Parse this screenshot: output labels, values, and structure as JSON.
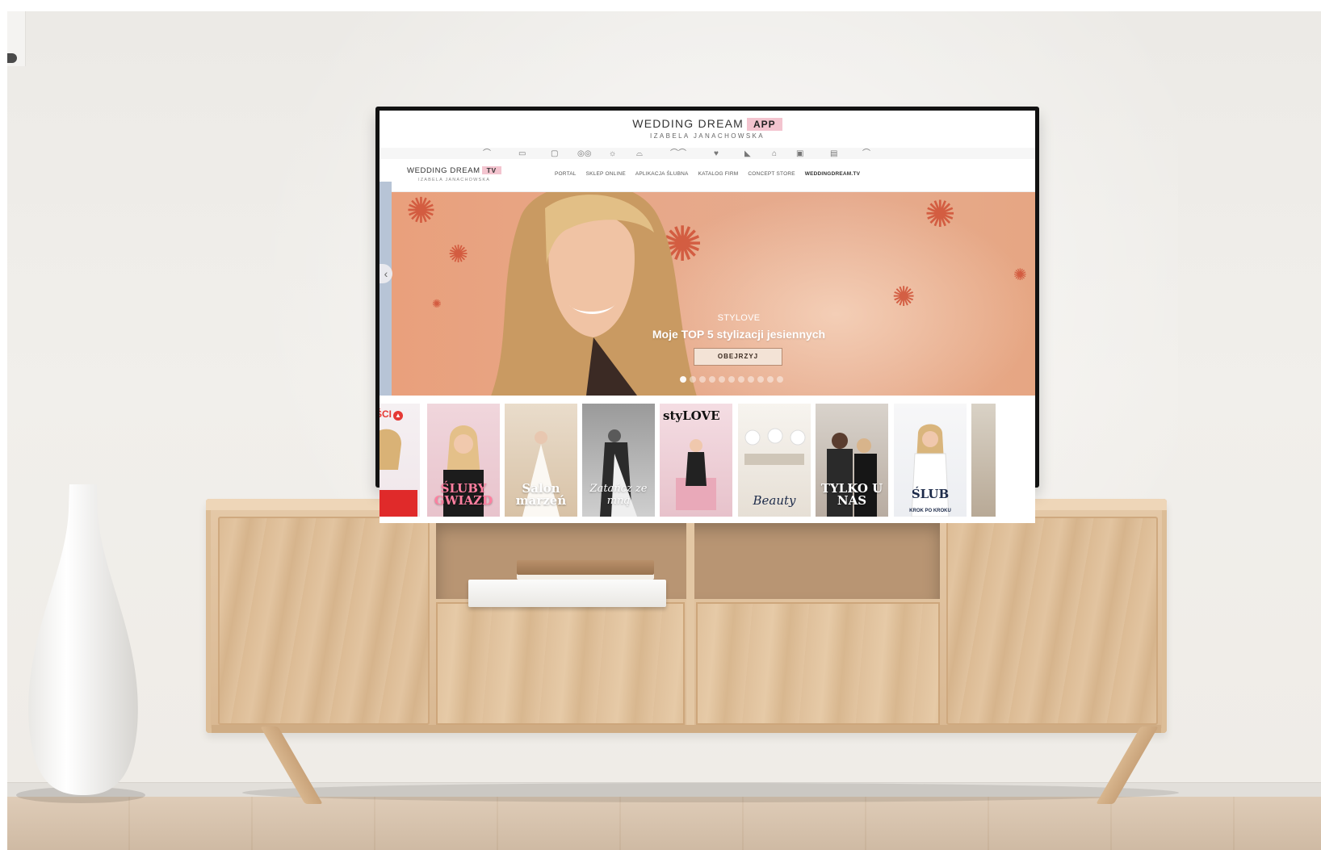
{
  "app_bar": {
    "title": "WEDDING DREAM",
    "badge": "APP",
    "subtitle": "IZABELA JANACHOWSKA"
  },
  "icon_row": [
    "home-icon",
    "calendar-icon",
    "document-icon",
    "rings-icon",
    "sun-icon",
    "person-icon",
    "car-icon",
    "heart-icon",
    "flag-icon",
    "cake-icon",
    "camera-icon",
    "list-icon",
    "music-icon"
  ],
  "site_header": {
    "logo_text": "WEDDING DREAM",
    "logo_badge": "TV",
    "logo_sub": "IZABELA JANACHOWSKA",
    "nav": [
      {
        "label": "PORTAL",
        "active": false
      },
      {
        "label": "SKLEP ONLINE",
        "active": false
      },
      {
        "label": "APLIKACJA ŚLUBNA",
        "active": false
      },
      {
        "label": "KATALOG FIRM",
        "active": false
      },
      {
        "label": "CONCEPT STORE",
        "active": false
      },
      {
        "label": "WEDDINGDREAM.TV",
        "active": true
      }
    ]
  },
  "hero": {
    "label": "STYLOVE",
    "title": "Moje TOP 5 stylizacji jesiennych",
    "button": "OBEJRZYJ",
    "slide_count": 11,
    "active_slide": 1,
    "prev_arrow": "‹"
  },
  "thumbnails": [
    {
      "id": "t0",
      "caption": "ŚCI",
      "style": "red-tag"
    },
    {
      "id": "t1",
      "caption": "ŚLUBY GWIAZD",
      "style": "pink-caption"
    },
    {
      "id": "t2",
      "caption": "Salon marzeń",
      "style": "white-caption"
    },
    {
      "id": "t3",
      "caption": "Zatańcz ze mną",
      "style": "script"
    },
    {
      "id": "t4",
      "caption": "styLOVE",
      "style": "top-label"
    },
    {
      "id": "t5",
      "caption": "Beauty",
      "style": "dark-script"
    },
    {
      "id": "t6",
      "caption": "TYLKO U NAS",
      "style": "white-caption"
    },
    {
      "id": "t7",
      "caption": "ŚLUB",
      "subcaption": "KROK PO KROKU",
      "style": "dark-caption"
    }
  ],
  "colors": {
    "brand_pink": "#f3c4cf",
    "hero_bg": "#e7a889",
    "tv_frame": "#121212"
  }
}
